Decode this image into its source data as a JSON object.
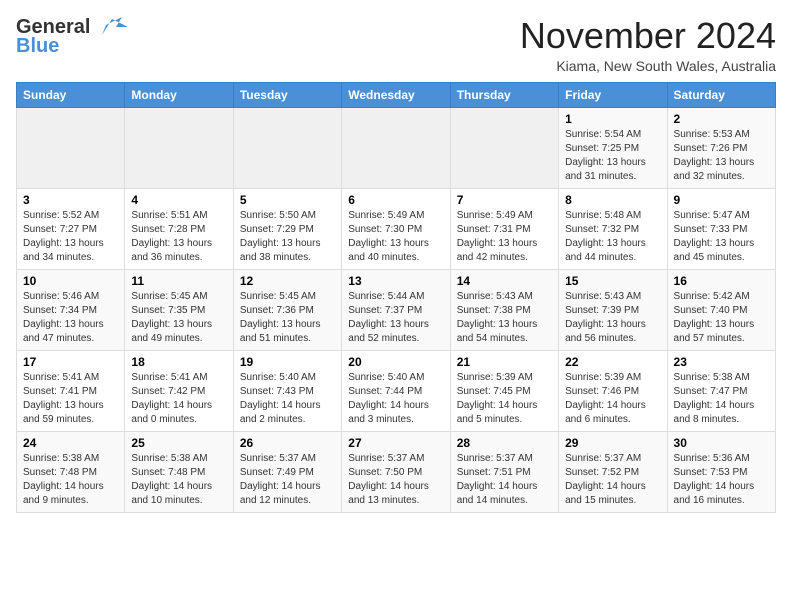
{
  "header": {
    "logo_general": "General",
    "logo_blue": "Blue",
    "month_title": "November 2024",
    "location": "Kiama, New South Wales, Australia"
  },
  "weekdays": [
    "Sunday",
    "Monday",
    "Tuesday",
    "Wednesday",
    "Thursday",
    "Friday",
    "Saturday"
  ],
  "weeks": [
    [
      {
        "day": "",
        "info": ""
      },
      {
        "day": "",
        "info": ""
      },
      {
        "day": "",
        "info": ""
      },
      {
        "day": "",
        "info": ""
      },
      {
        "day": "",
        "info": ""
      },
      {
        "day": "1",
        "info": "Sunrise: 5:54 AM\nSunset: 7:25 PM\nDaylight: 13 hours and 31 minutes."
      },
      {
        "day": "2",
        "info": "Sunrise: 5:53 AM\nSunset: 7:26 PM\nDaylight: 13 hours and 32 minutes."
      }
    ],
    [
      {
        "day": "3",
        "info": "Sunrise: 5:52 AM\nSunset: 7:27 PM\nDaylight: 13 hours and 34 minutes."
      },
      {
        "day": "4",
        "info": "Sunrise: 5:51 AM\nSunset: 7:28 PM\nDaylight: 13 hours and 36 minutes."
      },
      {
        "day": "5",
        "info": "Sunrise: 5:50 AM\nSunset: 7:29 PM\nDaylight: 13 hours and 38 minutes."
      },
      {
        "day": "6",
        "info": "Sunrise: 5:49 AM\nSunset: 7:30 PM\nDaylight: 13 hours and 40 minutes."
      },
      {
        "day": "7",
        "info": "Sunrise: 5:49 AM\nSunset: 7:31 PM\nDaylight: 13 hours and 42 minutes."
      },
      {
        "day": "8",
        "info": "Sunrise: 5:48 AM\nSunset: 7:32 PM\nDaylight: 13 hours and 44 minutes."
      },
      {
        "day": "9",
        "info": "Sunrise: 5:47 AM\nSunset: 7:33 PM\nDaylight: 13 hours and 45 minutes."
      }
    ],
    [
      {
        "day": "10",
        "info": "Sunrise: 5:46 AM\nSunset: 7:34 PM\nDaylight: 13 hours and 47 minutes."
      },
      {
        "day": "11",
        "info": "Sunrise: 5:45 AM\nSunset: 7:35 PM\nDaylight: 13 hours and 49 minutes."
      },
      {
        "day": "12",
        "info": "Sunrise: 5:45 AM\nSunset: 7:36 PM\nDaylight: 13 hours and 51 minutes."
      },
      {
        "day": "13",
        "info": "Sunrise: 5:44 AM\nSunset: 7:37 PM\nDaylight: 13 hours and 52 minutes."
      },
      {
        "day": "14",
        "info": "Sunrise: 5:43 AM\nSunset: 7:38 PM\nDaylight: 13 hours and 54 minutes."
      },
      {
        "day": "15",
        "info": "Sunrise: 5:43 AM\nSunset: 7:39 PM\nDaylight: 13 hours and 56 minutes."
      },
      {
        "day": "16",
        "info": "Sunrise: 5:42 AM\nSunset: 7:40 PM\nDaylight: 13 hours and 57 minutes."
      }
    ],
    [
      {
        "day": "17",
        "info": "Sunrise: 5:41 AM\nSunset: 7:41 PM\nDaylight: 13 hours and 59 minutes."
      },
      {
        "day": "18",
        "info": "Sunrise: 5:41 AM\nSunset: 7:42 PM\nDaylight: 14 hours and 0 minutes."
      },
      {
        "day": "19",
        "info": "Sunrise: 5:40 AM\nSunset: 7:43 PM\nDaylight: 14 hours and 2 minutes."
      },
      {
        "day": "20",
        "info": "Sunrise: 5:40 AM\nSunset: 7:44 PM\nDaylight: 14 hours and 3 minutes."
      },
      {
        "day": "21",
        "info": "Sunrise: 5:39 AM\nSunset: 7:45 PM\nDaylight: 14 hours and 5 minutes."
      },
      {
        "day": "22",
        "info": "Sunrise: 5:39 AM\nSunset: 7:46 PM\nDaylight: 14 hours and 6 minutes."
      },
      {
        "day": "23",
        "info": "Sunrise: 5:38 AM\nSunset: 7:47 PM\nDaylight: 14 hours and 8 minutes."
      }
    ],
    [
      {
        "day": "24",
        "info": "Sunrise: 5:38 AM\nSunset: 7:48 PM\nDaylight: 14 hours and 9 minutes."
      },
      {
        "day": "25",
        "info": "Sunrise: 5:38 AM\nSunset: 7:48 PM\nDaylight: 14 hours and 10 minutes."
      },
      {
        "day": "26",
        "info": "Sunrise: 5:37 AM\nSunset: 7:49 PM\nDaylight: 14 hours and 12 minutes."
      },
      {
        "day": "27",
        "info": "Sunrise: 5:37 AM\nSunset: 7:50 PM\nDaylight: 14 hours and 13 minutes."
      },
      {
        "day": "28",
        "info": "Sunrise: 5:37 AM\nSunset: 7:51 PM\nDaylight: 14 hours and 14 minutes."
      },
      {
        "day": "29",
        "info": "Sunrise: 5:37 AM\nSunset: 7:52 PM\nDaylight: 14 hours and 15 minutes."
      },
      {
        "day": "30",
        "info": "Sunrise: 5:36 AM\nSunset: 7:53 PM\nDaylight: 14 hours and 16 minutes."
      }
    ]
  ]
}
